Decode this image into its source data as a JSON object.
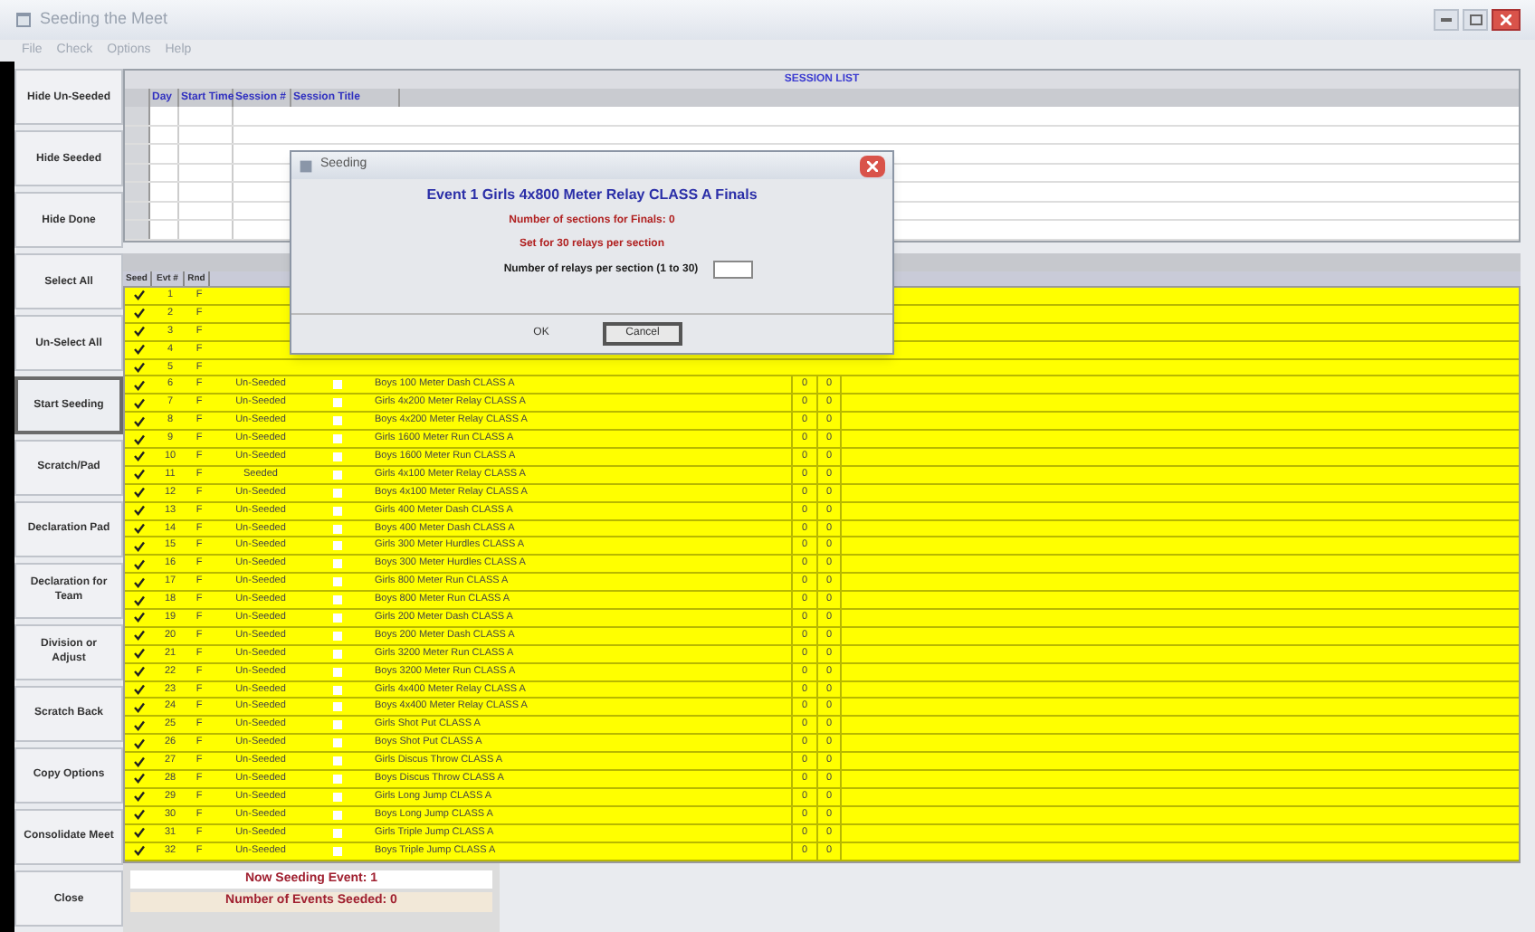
{
  "window": {
    "title": "Seeding the Meet"
  },
  "menu": [
    "File",
    "Check",
    "Options",
    "Help"
  ],
  "sidebar": [
    {
      "label": "Hide Un-Seeded",
      "selected": false
    },
    {
      "label": "Hide Seeded",
      "selected": false
    },
    {
      "label": "Hide Done",
      "selected": false
    },
    {
      "label": "Select All",
      "selected": false
    },
    {
      "label": "Un-Select All",
      "selected": false
    },
    {
      "label": "Start Seeding",
      "selected": true
    },
    {
      "label": "Scratch/Pad",
      "selected": false
    },
    {
      "label": "Declaration Pad",
      "selected": false
    },
    {
      "label": "Declaration for Team",
      "selected": false
    },
    {
      "label": "Division or Adjust",
      "selected": false
    },
    {
      "label": "Scratch Back",
      "selected": false
    },
    {
      "label": "Copy Options",
      "selected": false
    },
    {
      "label": "Consolidate Meet",
      "selected": false
    },
    {
      "label": "Close",
      "selected": false
    }
  ],
  "session_list": {
    "title": "SESSION LIST",
    "columns": [
      "Day",
      "Start Time",
      "Session #",
      "Session Title"
    ]
  },
  "events": {
    "columns": [
      "Seed",
      "Evt #",
      "Rnd"
    ],
    "rows": [
      {
        "seed": true,
        "event": "1",
        "round": "F"
      },
      {
        "seed": true,
        "event": "2",
        "round": "F"
      },
      {
        "seed": true,
        "event": "3",
        "round": "F"
      },
      {
        "seed": true,
        "event": "4",
        "round": "F"
      },
      {
        "seed": true,
        "event": "5",
        "round": "F"
      },
      {
        "seed": true,
        "event": "6",
        "round": "F",
        "status": "Un-Seeded",
        "flag": false,
        "name": "Boys 100 Meter Dash CLASS A",
        "column_7": "0",
        "column_8": "0"
      },
      {
        "seed": true,
        "event": "7",
        "round": "F",
        "status": "Un-Seeded",
        "flag": false,
        "name": "Girls 4x200 Meter Relay CLASS A",
        "column_7": "0",
        "column_8": "0"
      },
      {
        "seed": true,
        "event": "8",
        "round": "F",
        "status": "Un-Seeded",
        "flag": false,
        "name": "Boys 4x200 Meter Relay CLASS A",
        "column_7": "0",
        "column_8": "0"
      },
      {
        "seed": true,
        "event": "9",
        "round": "F",
        "status": "Un-Seeded",
        "flag": false,
        "name": "Girls 1600 Meter Run CLASS A",
        "column_7": "0",
        "column_8": "0"
      },
      {
        "seed": true,
        "event": "10",
        "round": "F",
        "status": "Un-Seeded",
        "flag": false,
        "name": "Boys 1600 Meter Run CLASS A",
        "column_7": "0",
        "column_8": "0"
      },
      {
        "seed": true,
        "event": "11",
        "round": "F",
        "status": "Seeded",
        "flag": false,
        "name": "Girls 4x100 Meter Relay CLASS A",
        "column_7": "0",
        "column_8": "0"
      },
      {
        "seed": true,
        "event": "12",
        "round": "F",
        "status": "Un-Seeded",
        "flag": false,
        "name": "Boys 4x100 Meter Relay CLASS A",
        "column_7": "0",
        "column_8": "0"
      },
      {
        "seed": true,
        "event": "13",
        "round": "F",
        "status": "Un-Seeded",
        "flag": false,
        "name": "Girls 400 Meter Dash CLASS A",
        "column_7": "0",
        "column_8": "0"
      },
      {
        "seed": true,
        "event": "14",
        "round": "F",
        "status": "Un-Seeded",
        "flag": false,
        "name": "Boys 400 Meter Dash CLASS A",
        "column_7": "0",
        "column_8": "0"
      },
      {
        "seed": true,
        "event": "15",
        "round": "F",
        "status": "Un-Seeded",
        "flag": false,
        "name": "Girls 300 Meter Hurdles CLASS A",
        "column_7": "0",
        "column_8": "0"
      },
      {
        "seed": true,
        "event": "16",
        "round": "F",
        "status": "Un-Seeded",
        "flag": false,
        "name": "Boys 300 Meter Hurdles CLASS A",
        "column_7": "0",
        "column_8": "0"
      },
      {
        "seed": true,
        "event": "17",
        "round": "F",
        "status": "Un-Seeded",
        "flag": false,
        "name": "Girls 800 Meter Run CLASS A",
        "column_7": "0",
        "column_8": "0"
      },
      {
        "seed": true,
        "event": "18",
        "round": "F",
        "status": "Un-Seeded",
        "flag": false,
        "name": "Boys 800 Meter Run CLASS A",
        "column_7": "0",
        "column_8": "0"
      },
      {
        "seed": true,
        "event": "19",
        "round": "F",
        "status": "Un-Seeded",
        "flag": false,
        "name": "Girls 200 Meter Dash CLASS A",
        "column_7": "0",
        "column_8": "0"
      },
      {
        "seed": true,
        "event": "20",
        "round": "F",
        "status": "Un-Seeded",
        "flag": false,
        "name": "Boys 200 Meter Dash CLASS A",
        "column_7": "0",
        "column_8": "0"
      },
      {
        "seed": true,
        "event": "21",
        "round": "F",
        "status": "Un-Seeded",
        "flag": false,
        "name": "Girls 3200 Meter Run CLASS A",
        "column_7": "0",
        "column_8": "0"
      },
      {
        "seed": true,
        "event": "22",
        "round": "F",
        "status": "Un-Seeded",
        "flag": false,
        "name": "Boys 3200 Meter Run CLASS A",
        "column_7": "0",
        "column_8": "0"
      },
      {
        "seed": true,
        "event": "23",
        "round": "F",
        "status": "Un-Seeded",
        "flag": false,
        "name": "Girls 4x400 Meter Relay CLASS A",
        "column_7": "0",
        "column_8": "0"
      },
      {
        "seed": true,
        "event": "24",
        "round": "F",
        "status": "Un-Seeded",
        "flag": false,
        "name": "Boys 4x400 Meter Relay CLASS A",
        "column_7": "0",
        "column_8": "0"
      },
      {
        "seed": true,
        "event": "25",
        "round": "F",
        "status": "Un-Seeded",
        "flag": false,
        "name": "Girls Shot Put CLASS A",
        "column_7": "0",
        "column_8": "0"
      },
      {
        "seed": true,
        "event": "26",
        "round": "F",
        "status": "Un-Seeded",
        "flag": false,
        "name": "Boys Shot Put CLASS A",
        "column_7": "0",
        "column_8": "0"
      },
      {
        "seed": true,
        "event": "27",
        "round": "F",
        "status": "Un-Seeded",
        "flag": false,
        "name": "Girls Discus Throw CLASS A",
        "column_7": "0",
        "column_8": "0"
      },
      {
        "seed": true,
        "event": "28",
        "round": "F",
        "status": "Un-Seeded",
        "flag": false,
        "name": "Boys Discus Throw CLASS A",
        "column_7": "0",
        "column_8": "0"
      },
      {
        "seed": true,
        "event": "29",
        "round": "F",
        "status": "Un-Seeded",
        "flag": false,
        "name": "Girls Long Jump CLASS A",
        "column_7": "0",
        "column_8": "0"
      },
      {
        "seed": true,
        "event": "30",
        "round": "F",
        "status": "Un-Seeded",
        "flag": false,
        "name": "Boys Long Jump CLASS A",
        "column_7": "0",
        "column_8": "0"
      },
      {
        "seed": true,
        "event": "31",
        "round": "F",
        "status": "Un-Seeded",
        "flag": false,
        "name": "Girls Triple Jump CLASS A",
        "column_7": "0",
        "column_8": "0"
      },
      {
        "seed": true,
        "event": "32",
        "round": "F",
        "status": "Un-Seeded",
        "flag": false,
        "name": "Boys Triple Jump CLASS A",
        "column_7": "0",
        "column_8": "0"
      }
    ]
  },
  "status": {
    "now_seeding": "Now Seeding Event: 1",
    "events_seeded": "Number of Events Seeded: 0"
  },
  "dialog": {
    "title": "Seeding",
    "event": "Event 1 Girls 4x800 Meter Relay CLASS A Finals",
    "sections": "Number of sections for Finals: 0",
    "relays_info": "Set for 30 relays per section",
    "relays_label": "Number of relays per section (1 to 30)",
    "buttons": [
      "OK",
      "Cancel"
    ]
  }
}
